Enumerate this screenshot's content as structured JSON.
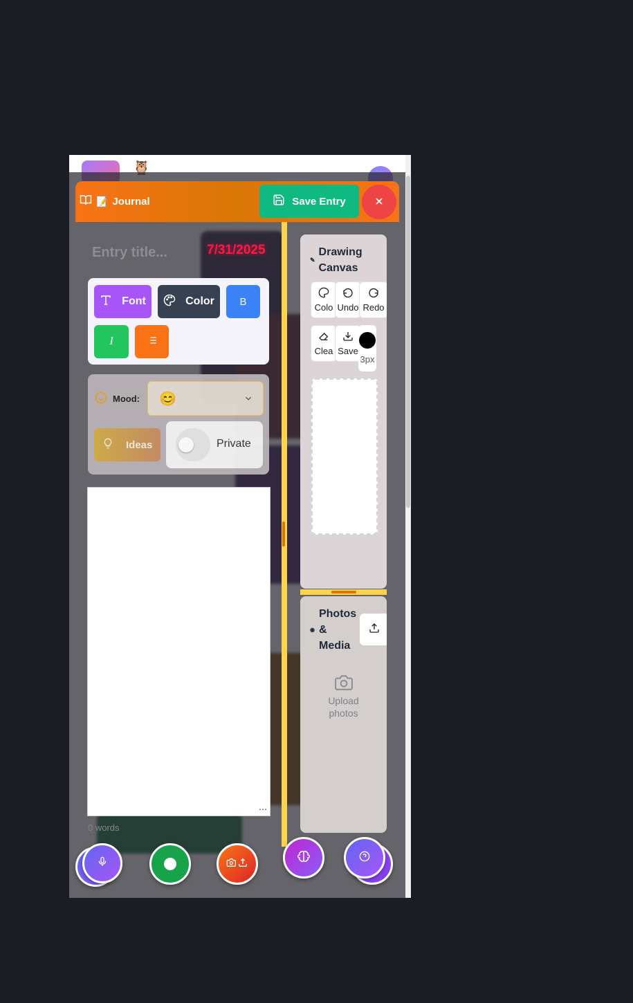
{
  "header": {
    "title": "Journal",
    "save_label": "Save Entry"
  },
  "entry": {
    "title_placeholder": "Entry title...",
    "date": "7/31/2025"
  },
  "format_toolbar": {
    "font_label": "Font",
    "color_label": "Color",
    "bold_label": "B",
    "italic_label": "I"
  },
  "mood": {
    "label": "Mood:",
    "selected": "😊"
  },
  "ideas_label": "Ideas",
  "private_label": "Private",
  "word_count": "0 words",
  "drawing": {
    "title_line1": "Drawing",
    "title_line2": "Canvas",
    "tools": {
      "color": "Colo",
      "undo": "Undo",
      "redo": "Redo",
      "clear": "Clea",
      "save": "Save"
    },
    "stroke_size": "3px"
  },
  "media": {
    "title_line1": "Photos",
    "title_line2": "&",
    "title_line3": "Media",
    "upload_line1": "Upload",
    "upload_line2": "photos"
  },
  "colors": {
    "header_orange": "#f97316",
    "save_green": "#10b981",
    "close_red": "#ef4444",
    "date_red": "#ff1744",
    "divider_yellow": "#fcd34d"
  }
}
